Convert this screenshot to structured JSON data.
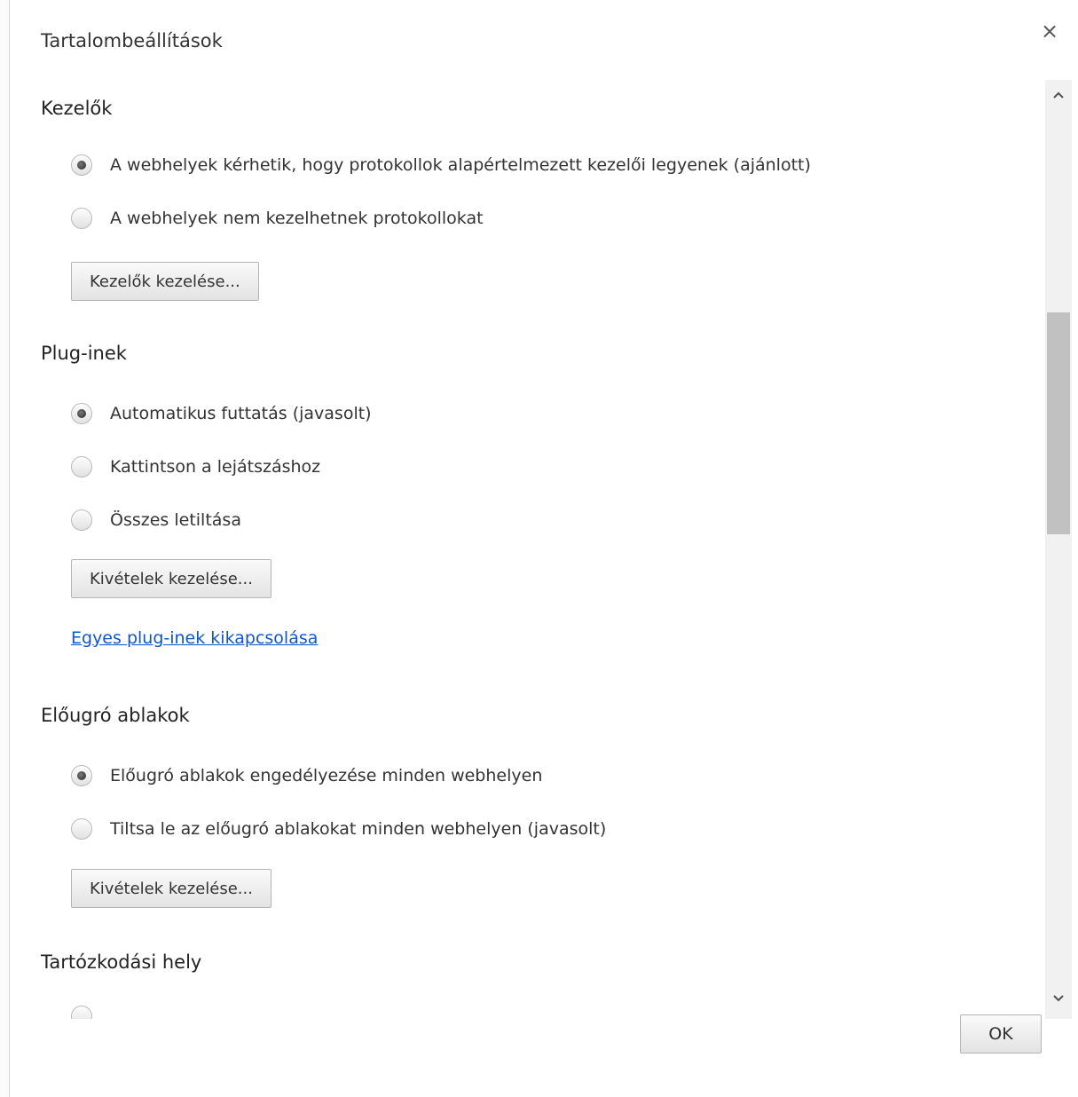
{
  "dialog": {
    "title": "Tartalombeállítások",
    "close_glyph": "×"
  },
  "sections": {
    "handlers": {
      "heading": "Kezelők",
      "options": [
        {
          "label": "A webhelyek kérhetik, hogy protokollok alapértelmezett kezelői legyenek (ajánlott)",
          "selected": true
        },
        {
          "label": "A webhelyek nem kezelhetnek protokollokat",
          "selected": false
        }
      ],
      "manage_button": "Kezelők kezelése..."
    },
    "plugins": {
      "heading": "Plug-inek",
      "options": [
        {
          "label": "Automatikus futtatás (javasolt)",
          "selected": true
        },
        {
          "label": "Kattintson a lejátszáshoz",
          "selected": false
        },
        {
          "label": "Összes letiltása",
          "selected": false
        }
      ],
      "manage_button": "Kivételek kezelése...",
      "disable_link": "Egyes plug-inek kikapcsolása"
    },
    "popups": {
      "heading": "Előugró ablakok",
      "options": [
        {
          "label": "Előugró ablakok engedélyezése minden webhelyen",
          "selected": true
        },
        {
          "label": "Tiltsa le az előugró ablakokat minden webhelyen (javasolt)",
          "selected": false
        }
      ],
      "manage_button": "Kivételek kezelése..."
    },
    "location": {
      "heading": "Tartózkodási hely"
    }
  },
  "scrollbar": {
    "up_icon": "chevron-up-icon",
    "down_icon": "chevron-down-icon"
  },
  "footer": {
    "ok_label": "OK"
  },
  "colors": {
    "link": "#1155cc",
    "text": "#333333",
    "scroll_thumb": "#c1c1c1"
  }
}
